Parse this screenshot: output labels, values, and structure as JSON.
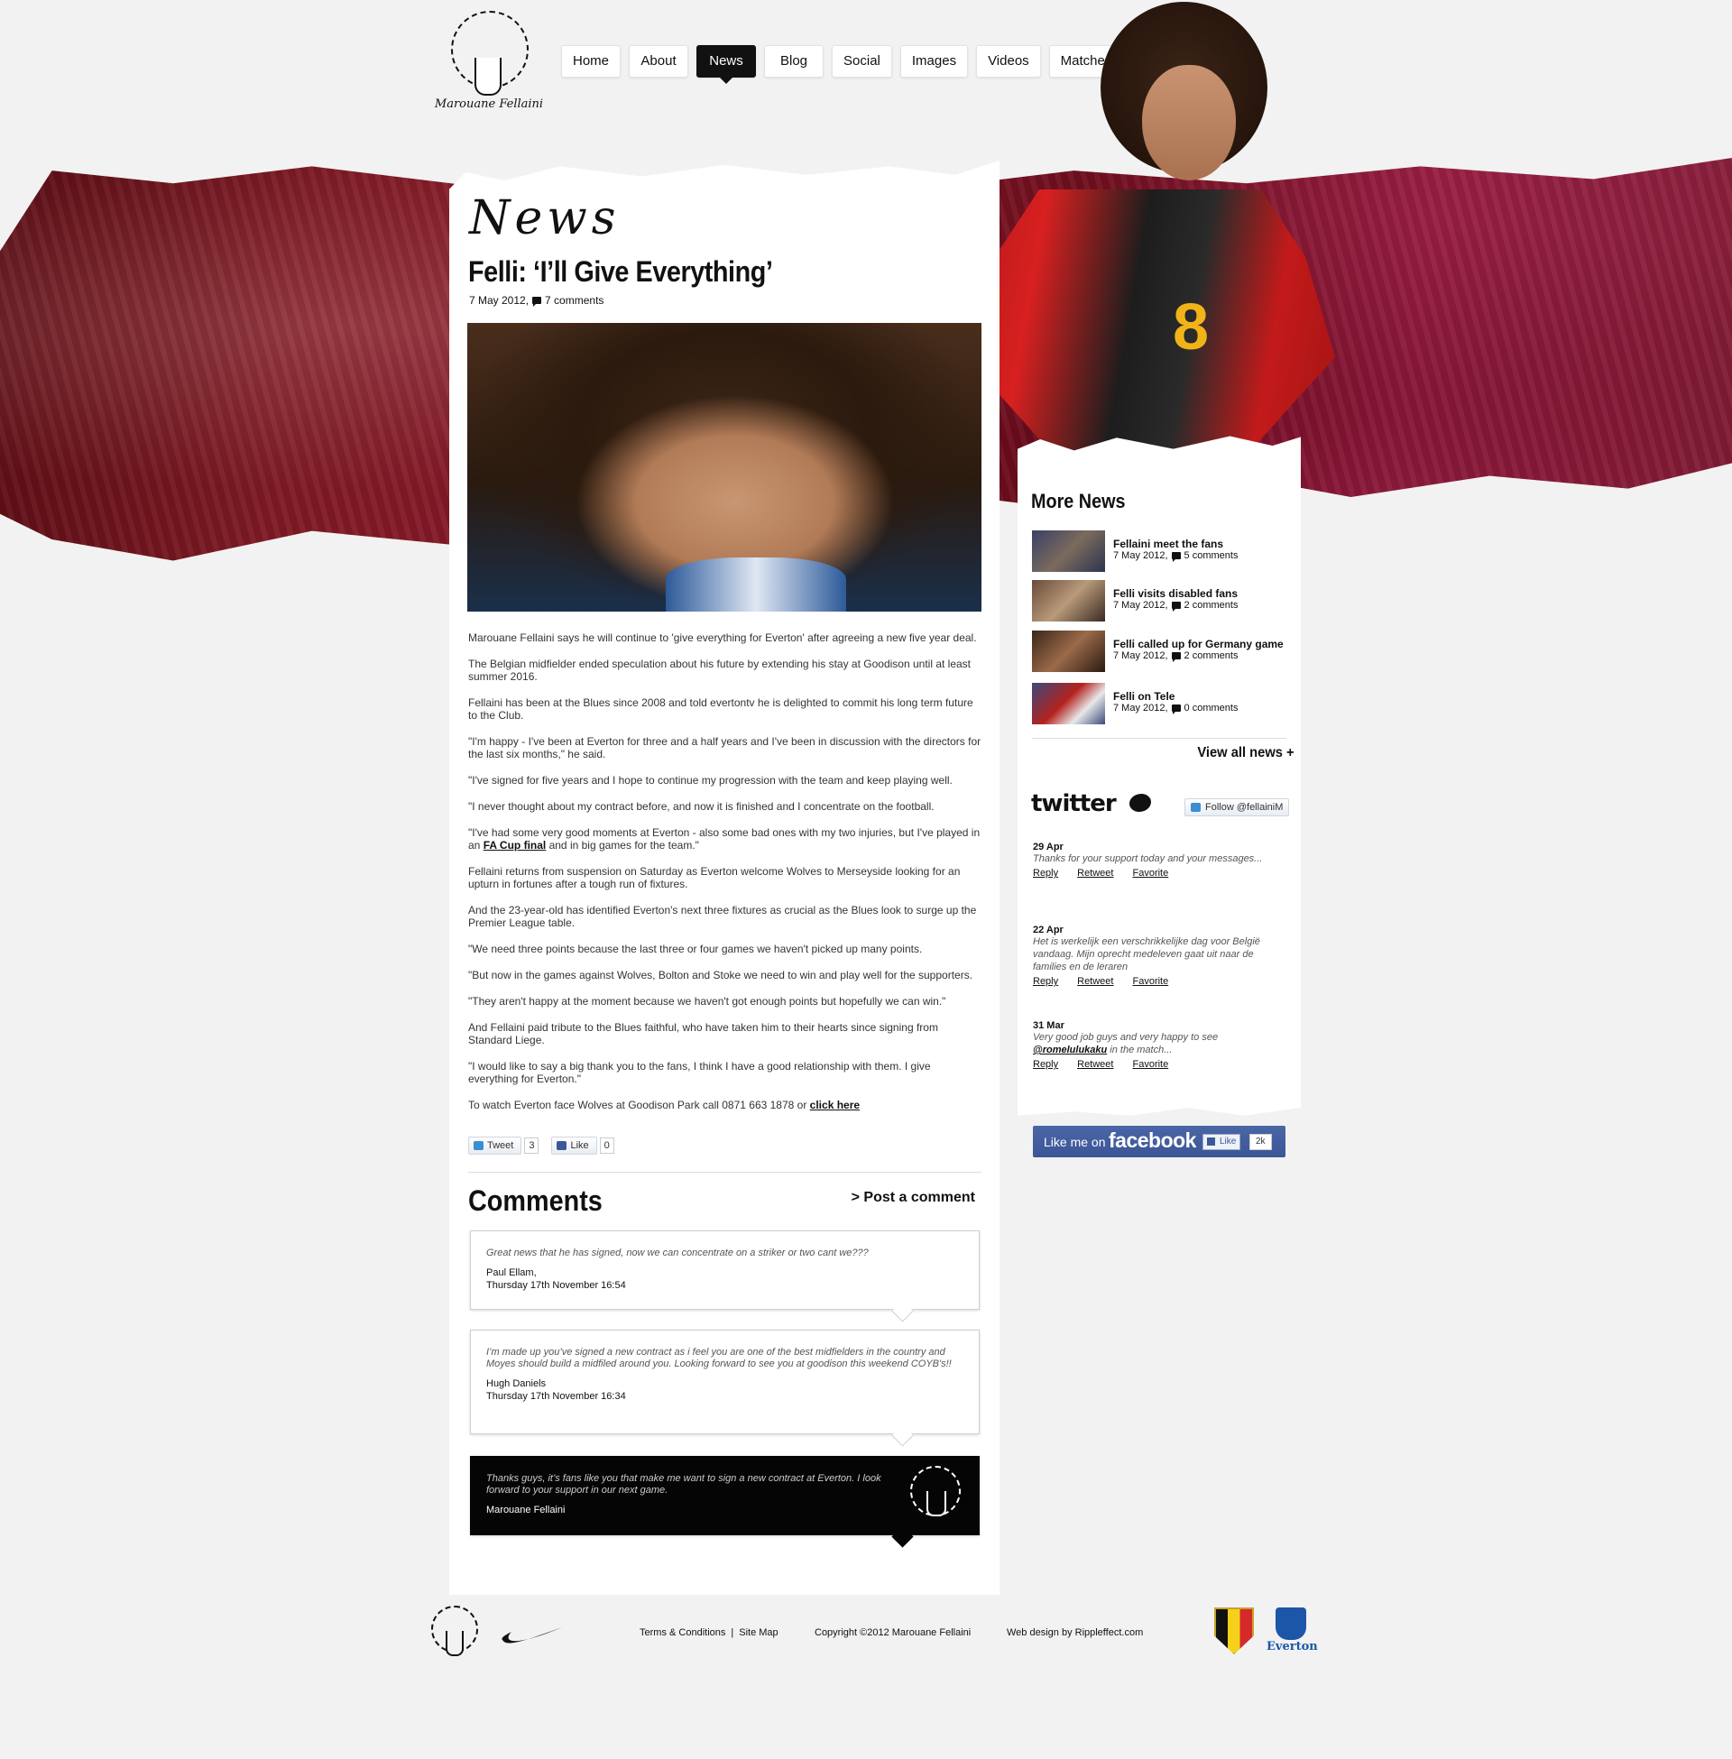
{
  "brand": {
    "name": "Marouane Fellaini",
    "shirt_number": "8"
  },
  "nav": [
    {
      "label": "Home",
      "active": false
    },
    {
      "label": "About",
      "active": false
    },
    {
      "label": "News",
      "active": true
    },
    {
      "label": "Blog",
      "active": false
    },
    {
      "label": "Social",
      "active": false
    },
    {
      "label": "Images",
      "active": false
    },
    {
      "label": "Videos",
      "active": false
    },
    {
      "label": "Matches",
      "active": false
    }
  ],
  "page": {
    "title": "News"
  },
  "article": {
    "title": "Felli: ‘I’ll Give Everything’",
    "date": "7 May 2012,",
    "comments": "7 comments",
    "paragraphs": [
      "Marouane Fellaini says he will continue to 'give everything for Everton' after agreeing a new five year deal.",
      "The Belgian midfielder ended speculation about his future by extending his stay at Goodison until at least summer 2016.",
      "Fellaini has been at the Blues since 2008 and told evertontv he is delighted to commit his long term future to the Club.",
      "\"I'm happy - I've been at Everton for three and a half years and I've been in discussion with the directors for the last six months,\" he said.",
      "\"I've signed for five years and I hope to continue my progression with the team and keep playing well.",
      "\"I never thought about my contract before, and now it is finished and I concentrate on the football."
    ],
    "p7_before": "\"I've had some very good moments at Everton - also some bad ones with my two injuries, but I've played in an ",
    "p7_link": "FA Cup final",
    "p7_after": " and in big games for the team.\"",
    "paragraphs2": [
      "Fellaini returns from suspension on Saturday as Everton welcome Wolves to Merseyside looking for an upturn in fortunes after a tough run of fixtures.",
      "And the 23-year-old has identified Everton's next three fixtures as crucial as the Blues look to surge up the Premier League table.",
      "\"We need three points because the last three or four games we haven't picked up many points.",
      "\"But now in the games against Wolves, Bolton and Stoke we need to win and play well for the supporters.",
      "\"They aren't happy at the moment because we haven't got enough points but hopefully we can win.\"",
      "And Fellaini paid tribute to the Blues faithful, who have taken him to their hearts since signing from Standard Liege.",
      "\"I would like to say a big thank you to the fans, I think I have a good relationship with them. I give everything for Everton.\""
    ],
    "last_before": "To watch Everton face Wolves at Goodison Park call 0871 663 1878 or ",
    "last_link": "click here"
  },
  "share": {
    "tweet_label": "Tweet",
    "tweet_count": "3",
    "like_label": "Like",
    "like_count": "0"
  },
  "comments_section": {
    "title": "Comments",
    "post_label": "> Post a comment",
    "items": [
      {
        "text": "Great news that he has signed, now we can concentrate on a striker or two cant we???",
        "author": "Paul Ellam,",
        "date": "Thursday 17th November 16:54"
      },
      {
        "text": "I’m made up you’ve signed a new contract as i feel you are one of the best midfielders in the country and Moyes should build a midfiled around you. Looking forward to see you at goodison this weekend COYB's!!",
        "author": "Hugh Daniels",
        "date": "Thursday 17th November 16:34"
      },
      {
        "text": "Thanks guys, it’s fans like you that make me want to sign a new contract at Everton. I look forward to your support in our next game.",
        "author": "Marouane Fellaini"
      }
    ]
  },
  "sidebar": {
    "more_news_title": "More News",
    "news": [
      {
        "title": "Fellaini meet the fans",
        "date": "7 May 2012,",
        "comments": "5 comments"
      },
      {
        "title": "Felli visits disabled fans",
        "date": "7 May 2012,",
        "comments": "2 comments"
      },
      {
        "title": "Felli called up for Germany game",
        "date": "7 May 2012,",
        "comments": "2 comments"
      },
      {
        "title": "Felli on Tele",
        "date": "7 May 2012,",
        "comments": "0 comments"
      }
    ],
    "view_all": "View all news +",
    "twitter": {
      "logo": "twitter",
      "follow": "Follow @fellainiM",
      "tweets": [
        {
          "date": "29 Apr",
          "text": "Thanks for your support today and your messages..."
        },
        {
          "date": "22 Apr",
          "text": "Het is werkelijk een verschrikkelijke dag voor België vandaag. Mijn oprecht medeleven gaat uit naar de families en de leraren"
        },
        {
          "date": "31 Mar",
          "text_before": "Very good job guys and very happy to see ",
          "mention": "@romelulukaku",
          "text_after": " in the match..."
        }
      ],
      "actions": {
        "reply": "Reply",
        "retweet": "Retweet",
        "favorite": "Favorite"
      }
    },
    "facebook": {
      "label": "Like me on",
      "brand": "facebook",
      "like": "Like",
      "count": "2k"
    }
  },
  "footer": {
    "terms": "Terms & Conditions",
    "sep": "|",
    "sitemap": "Site Map",
    "copyright": "Copyright ©2012 Marouane Fellaini",
    "credit": "Web design by Rippleffect.com",
    "everton_label": "Everton"
  },
  "colors": {
    "accent": "#111111",
    "band": "#8c1a2b",
    "facebook": "#3b5998",
    "everton": "#1b56a8"
  }
}
